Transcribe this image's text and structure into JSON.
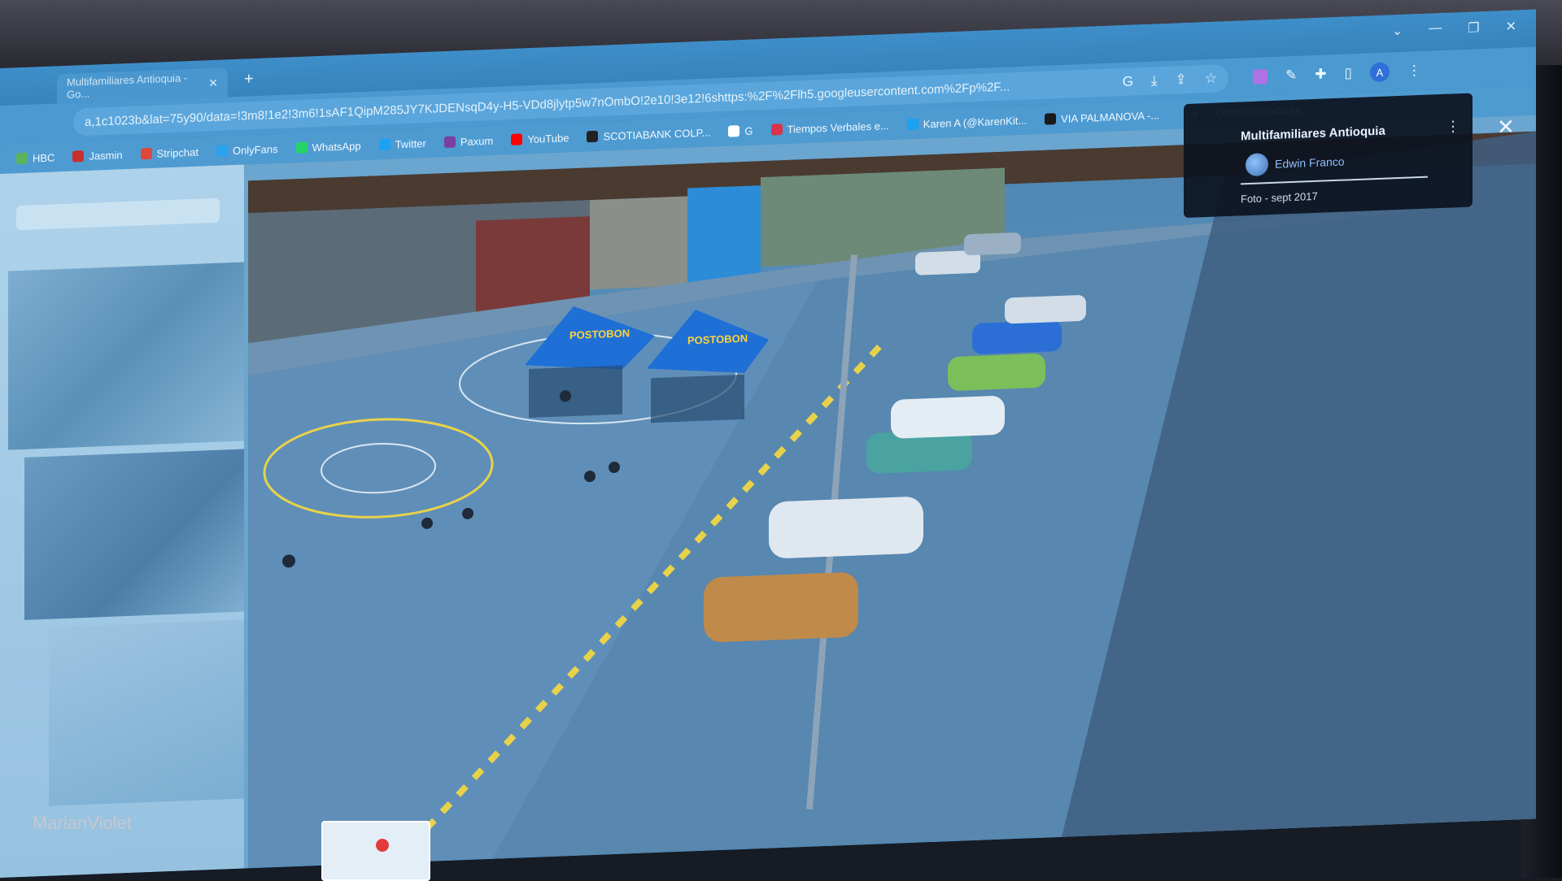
{
  "browser": {
    "tab_title": "Multifamiliares Antioquia - Go...",
    "new_tab": "+",
    "url": "a,1c1023b&lat=75y90/data=!3m8!1e2!3m6!1sAF1QipM285JY7KJDENsqD4y-H5-VDd8jlytp5w7nOmbO!2e10!3e12!6shttps:%2F%2Flh5.googleusercontent.com%2Fp%2F...",
    "window_controls": [
      "⌄",
      "—",
      "❐",
      "✕"
    ]
  },
  "bookmarks": [
    {
      "label": "HBC",
      "color": "#5bb35b"
    },
    {
      "label": "Jasmin",
      "color": "#c9302c"
    },
    {
      "label": "Stripchat",
      "color": "#e0473c"
    },
    {
      "label": "OnlyFans",
      "color": "#2aa3ef"
    },
    {
      "label": "WhatsApp",
      "color": "#25d366"
    },
    {
      "label": "Twitter",
      "color": "#1da1f2"
    },
    {
      "label": "Paxum",
      "color": "#7a3fa0"
    },
    {
      "label": "YouTube",
      "color": "#ff0000"
    },
    {
      "label": "SCOTIABANK COLP...",
      "color": "#222222"
    },
    {
      "label": "G",
      "color": "#ffffff"
    },
    {
      "label": "Tiempos Verbales e...",
      "color": "#d9344b"
    },
    {
      "label": "Karen A (@KarenKit...",
      "color": "#1da1f2"
    },
    {
      "label": "VIA PALMANOVA -...",
      "color": "#1a1a1a"
    }
  ],
  "bookmarks_more": "»",
  "bookmarks_other": "Otros marcadores",
  "photo_info": {
    "title": "Multifamiliares Antioquia",
    "author": "Edwin Franco",
    "date": "Foto - sept 2017"
  },
  "watermark": "MarianViolet",
  "tent_brand": "POSTOBON",
  "colors": {
    "accent": "#8ec0ff",
    "court_line": "#e8d24a"
  }
}
